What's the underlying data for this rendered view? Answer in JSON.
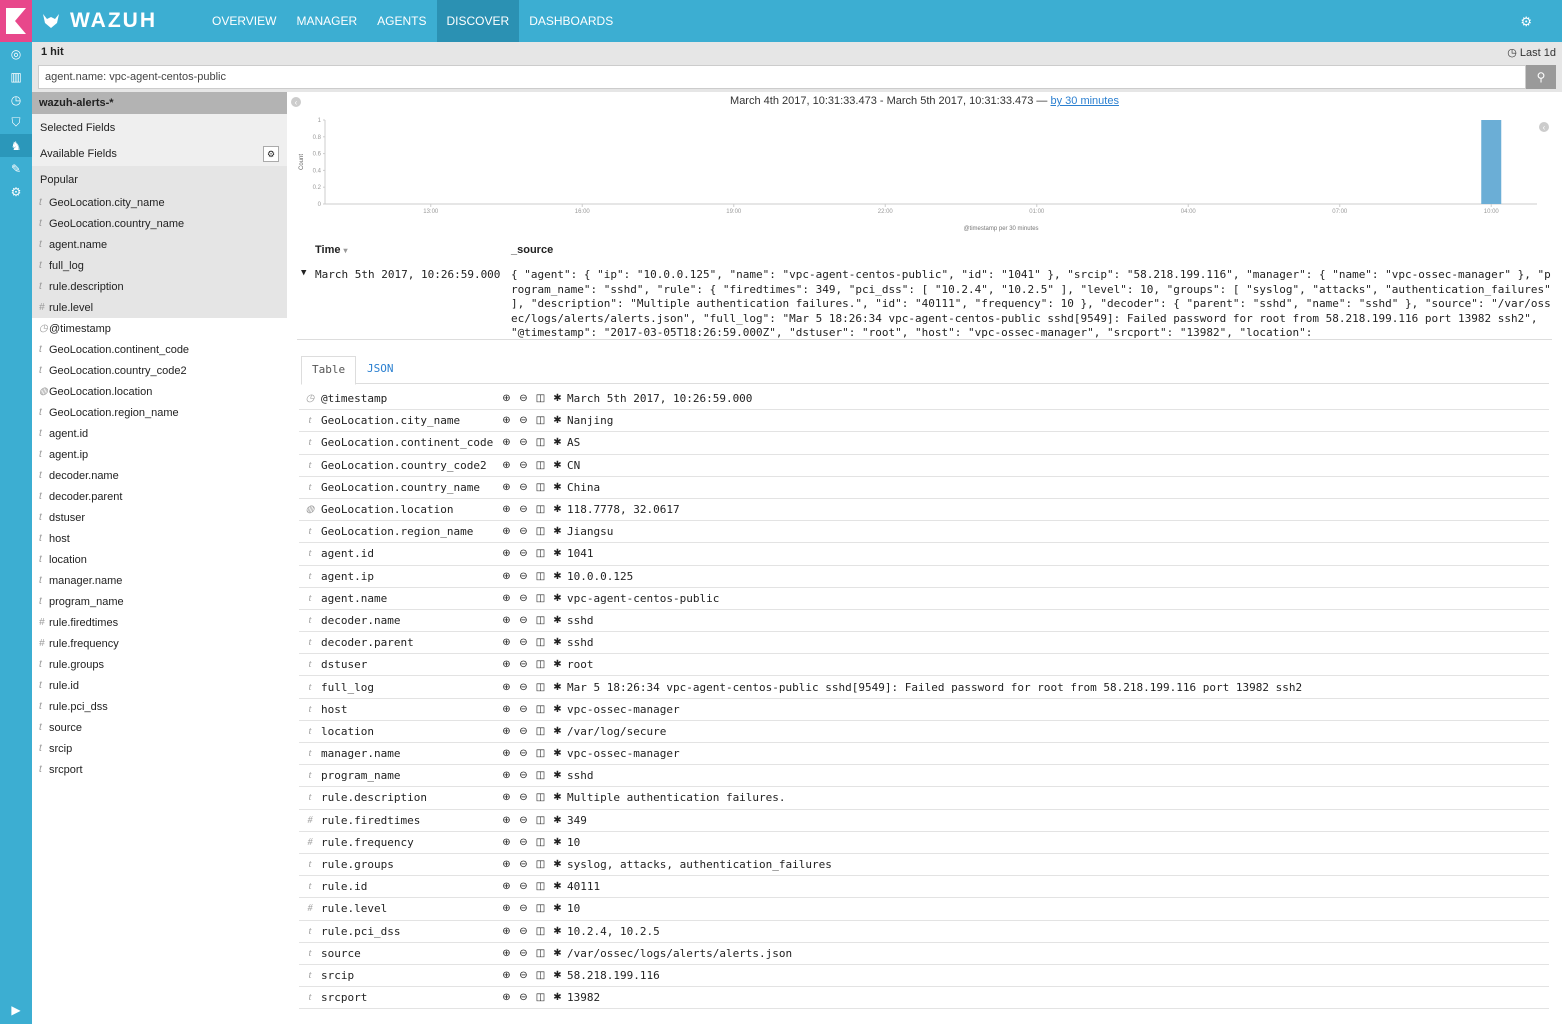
{
  "app": {
    "brand": "WAZUH"
  },
  "nav": {
    "items": [
      "OVERVIEW",
      "MANAGER",
      "AGENTS",
      "DISCOVER",
      "DASHBOARDS"
    ]
  },
  "subheader": {
    "hits": "1 hit",
    "time_range": "Last 1d"
  },
  "search": {
    "query": "agent.name: vpc-agent-centos-public"
  },
  "sidebar": {
    "index_pattern": "wazuh-alerts-*",
    "selected_fields": "Selected Fields",
    "available_fields": "Available Fields",
    "popular": "Popular",
    "popular_fields": [
      {
        "type": "t",
        "name": "GeoLocation.city_name"
      },
      {
        "type": "t",
        "name": "GeoLocation.country_name"
      },
      {
        "type": "t",
        "name": "agent.name"
      },
      {
        "type": "t",
        "name": "full_log"
      },
      {
        "type": "t",
        "name": "rule.description"
      },
      {
        "type": "#",
        "name": "rule.level"
      }
    ],
    "other_fields": [
      {
        "type": "◷",
        "name": "@timestamp"
      },
      {
        "type": "t",
        "name": "GeoLocation.continent_code"
      },
      {
        "type": "t",
        "name": "GeoLocation.country_code2"
      },
      {
        "type": "◍",
        "name": "GeoLocation.location"
      },
      {
        "type": "t",
        "name": "GeoLocation.region_name"
      },
      {
        "type": "t",
        "name": "agent.id"
      },
      {
        "type": "t",
        "name": "agent.ip"
      },
      {
        "type": "t",
        "name": "decoder.name"
      },
      {
        "type": "t",
        "name": "decoder.parent"
      },
      {
        "type": "t",
        "name": "dstuser"
      },
      {
        "type": "t",
        "name": "host"
      },
      {
        "type": "t",
        "name": "location"
      },
      {
        "type": "t",
        "name": "manager.name"
      },
      {
        "type": "t",
        "name": "program_name"
      },
      {
        "type": "#",
        "name": "rule.firedtimes"
      },
      {
        "type": "#",
        "name": "rule.frequency"
      },
      {
        "type": "t",
        "name": "rule.groups"
      },
      {
        "type": "t",
        "name": "rule.id"
      },
      {
        "type": "t",
        "name": "rule.pci_dss"
      },
      {
        "type": "t",
        "name": "source"
      },
      {
        "type": "t",
        "name": "srcip"
      },
      {
        "type": "t",
        "name": "srcport"
      }
    ]
  },
  "histogram": {
    "range_text": "March 4th 2017, 10:31:33.473 - March 5th 2017, 10:31:33.473 —",
    "interval_link": "by 30 minutes"
  },
  "chart_data": {
    "type": "bar",
    "ylabel": "Count",
    "xlabel": "@timestamp per 30 minutes",
    "yticks": [
      "1",
      "0.8",
      "0.6",
      "0.4",
      "0.2",
      "0"
    ],
    "xticks": [
      "13:00",
      "16:00",
      "19:00",
      "22:00",
      "01:00",
      "04:00",
      "07:00",
      "10:00"
    ],
    "ylim": [
      0,
      1
    ],
    "series": [
      {
        "x": "10:00",
        "value": 1
      }
    ]
  },
  "doc_table": {
    "col_time": "Time",
    "col_source": "_source",
    "row_time": "March 5th 2017, 10:26:59.000",
    "row_source": "{ \"agent\": { \"ip\": \"10.0.0.125\", \"name\": \"vpc-agent-centos-public\", \"id\": \"1041\" }, \"srcip\": \"58.218.199.116\", \"manager\": { \"name\": \"vpc-ossec-manager\" }, \"program_name\": \"sshd\", \"rule\": { \"firedtimes\": 349, \"pci_dss\": [ \"10.2.4\", \"10.2.5\" ], \"level\": 10, \"groups\": [ \"syslog\", \"attacks\", \"authentication_failures\" ], \"description\": \"Multiple authentication failures.\", \"id\": \"40111\", \"frequency\": 10 }, \"decoder\": { \"parent\": \"sshd\", \"name\": \"sshd\" }, \"source\": \"/var/ossec/logs/alerts/alerts.json\", \"full_log\": \"Mar 5 18:26:34 vpc-agent-centos-public sshd[9549]: Failed password for root from 58.218.199.116 port 13982 ssh2\", \"@timestamp\": \"2017-03-05T18:26:59.000Z\", \"dstuser\": \"root\", \"host\": \"vpc-ossec-manager\", \"srcport\": \"13982\", \"location\":"
  },
  "detail": {
    "tabs": [
      "Table",
      "JSON"
    ],
    "rows": [
      {
        "type": "◷",
        "field": "@timestamp",
        "value": "March 5th 2017, 10:26:59.000"
      },
      {
        "type": "t",
        "field": "GeoLocation.city_name",
        "value": "Nanjing"
      },
      {
        "type": "t",
        "field": "GeoLocation.continent_code",
        "value": "AS"
      },
      {
        "type": "t",
        "field": "GeoLocation.country_code2",
        "value": "CN"
      },
      {
        "type": "t",
        "field": "GeoLocation.country_name",
        "value": "China"
      },
      {
        "type": "◍",
        "field": "GeoLocation.location",
        "value": "118.7778, 32.0617"
      },
      {
        "type": "t",
        "field": "GeoLocation.region_name",
        "value": "Jiangsu"
      },
      {
        "type": "t",
        "field": "agent.id",
        "value": "1041"
      },
      {
        "type": "t",
        "field": "agent.ip",
        "value": "10.0.0.125"
      },
      {
        "type": "t",
        "field": "agent.name",
        "value": "vpc-agent-centos-public"
      },
      {
        "type": "t",
        "field": "decoder.name",
        "value": "sshd"
      },
      {
        "type": "t",
        "field": "decoder.parent",
        "value": "sshd"
      },
      {
        "type": "t",
        "field": "dstuser",
        "value": "root"
      },
      {
        "type": "t",
        "field": "full_log",
        "value": "Mar  5 18:26:34 vpc-agent-centos-public sshd[9549]: Failed password for root from 58.218.199.116 port 13982 ssh2"
      },
      {
        "type": "t",
        "field": "host",
        "value": "vpc-ossec-manager"
      },
      {
        "type": "t",
        "field": "location",
        "value": "/var/log/secure"
      },
      {
        "type": "t",
        "field": "manager.name",
        "value": "vpc-ossec-manager"
      },
      {
        "type": "t",
        "field": "program_name",
        "value": "sshd"
      },
      {
        "type": "t",
        "field": "rule.description",
        "value": "Multiple authentication failures."
      },
      {
        "type": "#",
        "field": "rule.firedtimes",
        "value": "349"
      },
      {
        "type": "#",
        "field": "rule.frequency",
        "value": "10"
      },
      {
        "type": "t",
        "field": "rule.groups",
        "value": "syslog, attacks, authentication_failures"
      },
      {
        "type": "t",
        "field": "rule.id",
        "value": "40111"
      },
      {
        "type": "#",
        "field": "rule.level",
        "value": "10"
      },
      {
        "type": "t",
        "field": "rule.pci_dss",
        "value": "10.2.4, 10.2.5"
      },
      {
        "type": "t",
        "field": "source",
        "value": "/var/ossec/logs/alerts/alerts.json"
      },
      {
        "type": "t",
        "field": "srcip",
        "value": "58.218.199.116"
      },
      {
        "type": "t",
        "field": "srcport",
        "value": "13982"
      }
    ]
  },
  "colors": {
    "primary": "#3caed2",
    "accent": "#e8478b",
    "active_nav": "#2b91b3",
    "bar": "#6baed6"
  }
}
